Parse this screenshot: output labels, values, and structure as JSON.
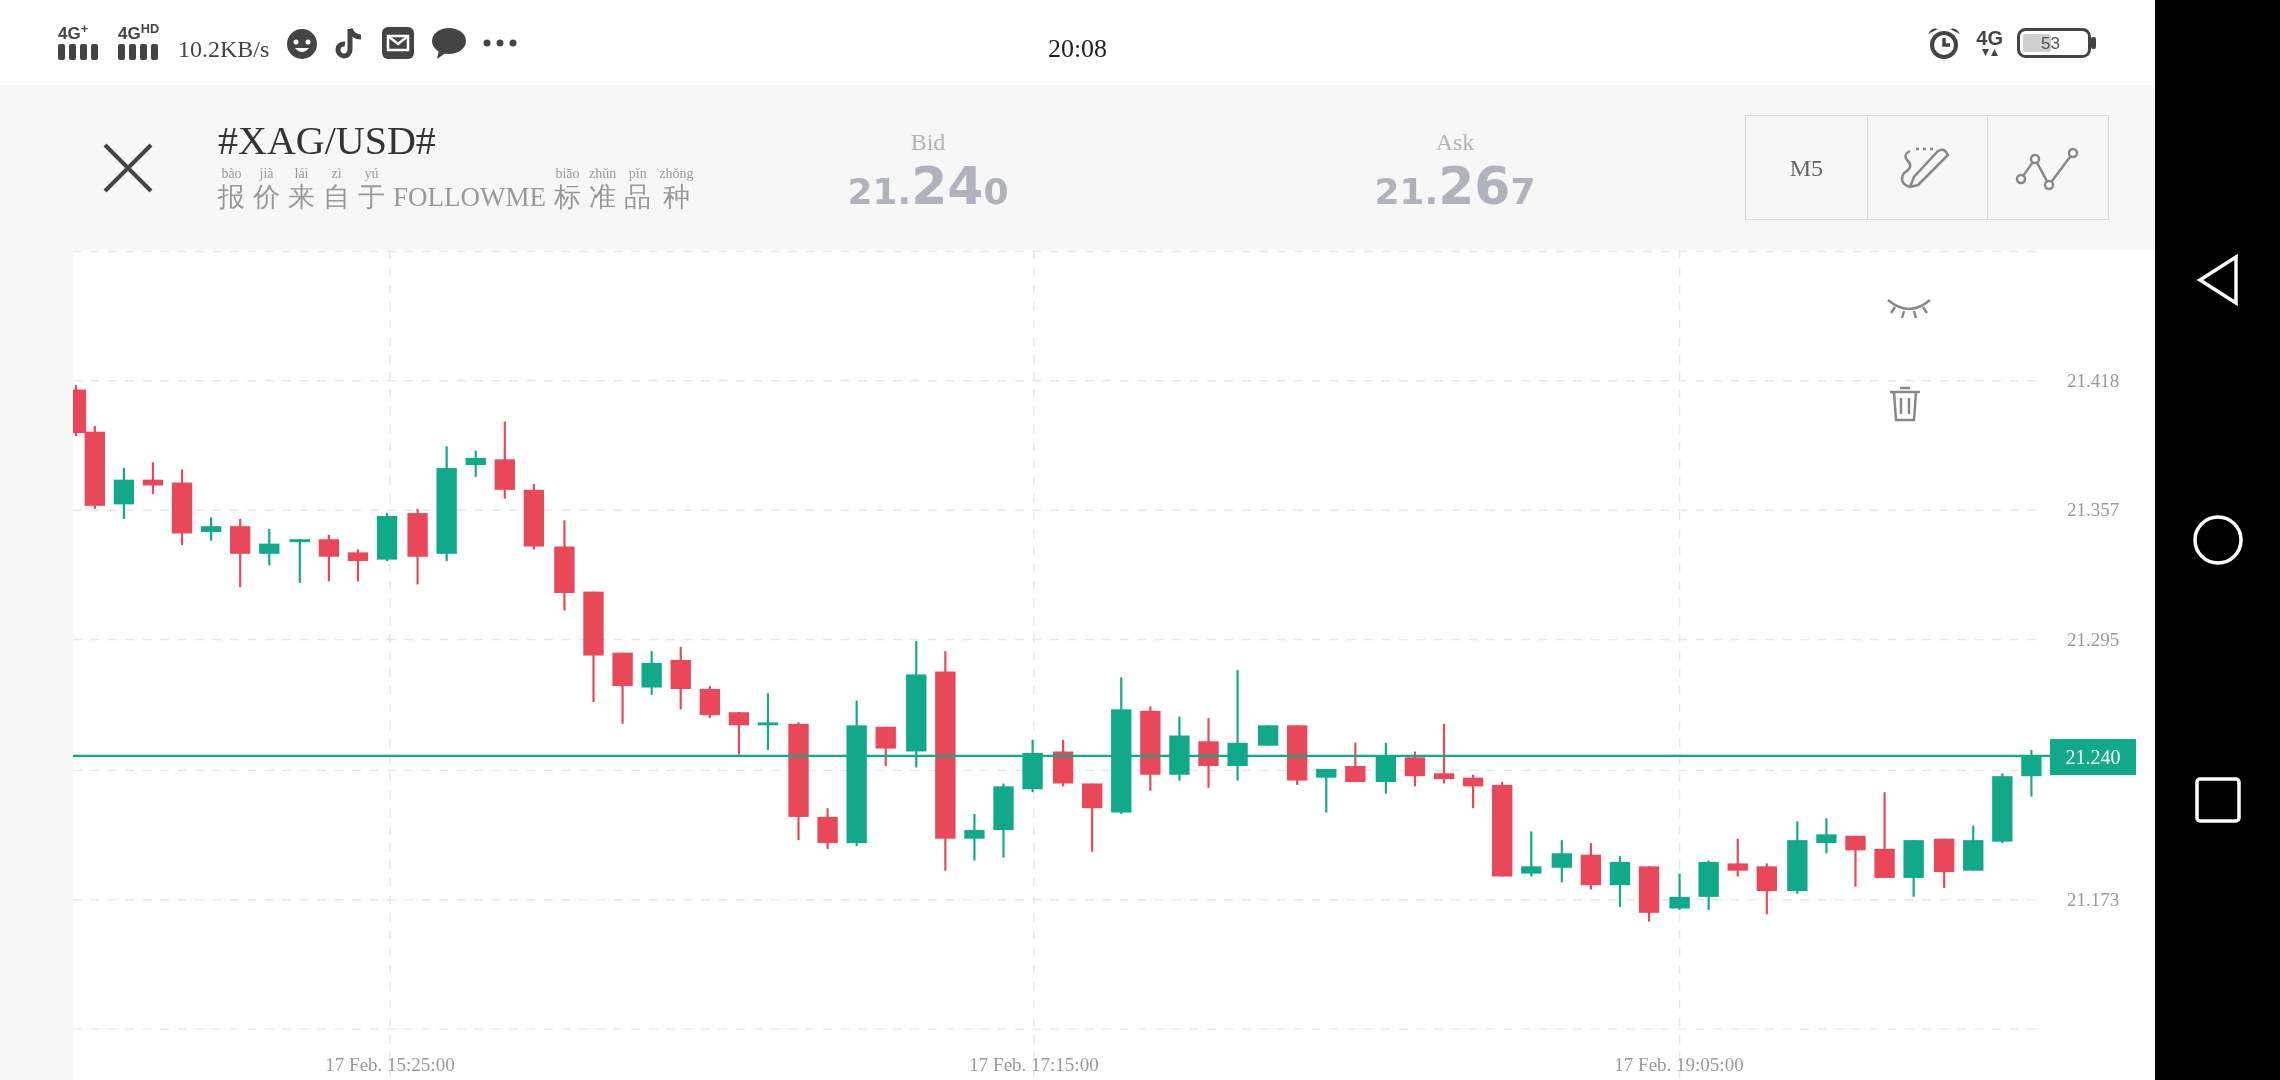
{
  "status_bar": {
    "network_1": "4G$^{+}$",
    "network_2": "4G$^{HD}$",
    "speed": "10.2KB/s",
    "time": "20:08",
    "network_3": "4G",
    "battery": "53"
  },
  "header": {
    "symbol": "#XAG/USD#",
    "source": [
      {
        "text": "报",
        "pinyin": "bào"
      },
      {
        "text": "价",
        "pinyin": "jià"
      },
      {
        "text": "来",
        "pinyin": "lái"
      },
      {
        "text": "自",
        "pinyin": "zì"
      },
      {
        "text": "于",
        "pinyin": "yú"
      },
      {
        "text": "FOLLOWME"
      },
      {
        "text": "标",
        "pinyin": "biāo"
      },
      {
        "text": "准",
        "pinyin": "zhǔn"
      },
      {
        "text": "品",
        "pinyin": "pǐn"
      },
      {
        "text": "种",
        "pinyin": "zhǒng"
      }
    ],
    "quotes": [
      {
        "label": "Bid",
        "price_prefix": "21.",
        "price_main": "24",
        "price_suffix": "0"
      },
      {
        "label": "Ask",
        "price_prefix": "21.",
        "price_main": "26",
        "price_suffix": "7"
      }
    ],
    "tools": [
      {
        "kind": "text",
        "label": "M5"
      },
      {
        "kind": "draw"
      },
      {
        "kind": "line"
      }
    ]
  },
  "chart": {
    "y_axis_labels": [
      "21.418",
      "21.357",
      "21.295",
      "21.173"
    ],
    "x_axis_labels": [
      "17 Feb. 15:25:00",
      "17 Feb. 17:15:00",
      "17 Feb. 19:05:00"
    ],
    "current_price": "21.240"
  }
}
